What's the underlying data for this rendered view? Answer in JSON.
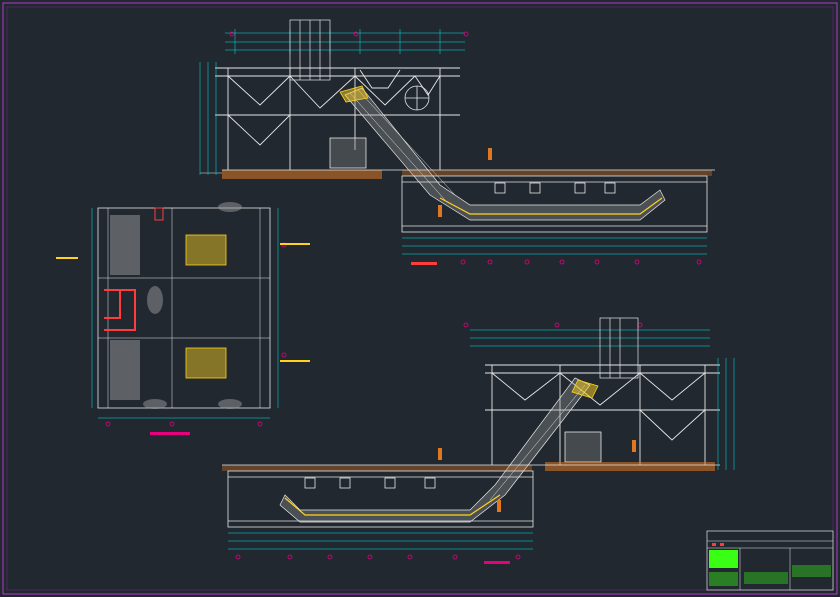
{
  "drawing": {
    "title_block": {
      "line_1": "",
      "line_2": "",
      "drawing_title": "",
      "drawing_subtitle": "",
      "sheet_no": ""
    }
  },
  "colors": {
    "background": "#212830",
    "frame": "#b43cc8",
    "structure": "#e6e6e6",
    "dimension": "#00e5e5",
    "accent_yellow": "#ffd21e",
    "ground_orange": "#e07820",
    "grid_marker": "#e6007e",
    "plan_red": "#ff3c3c",
    "hatch_gray": "#9a9a9a",
    "green_fill": "#39ff14"
  }
}
